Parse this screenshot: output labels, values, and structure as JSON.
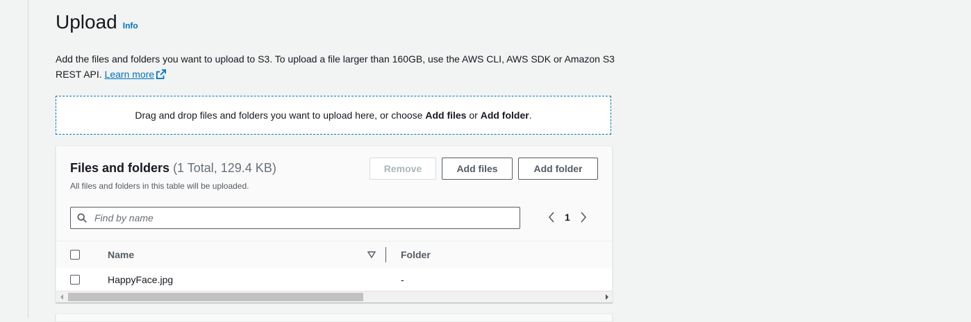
{
  "header": {
    "title": "Upload",
    "info_link": "Info"
  },
  "description": {
    "text": "Add the files and folders you want to upload to S3. To upload a file larger than 160GB, use the AWS CLI, AWS SDK or Amazon S3 REST API.",
    "learn_more": "Learn more"
  },
  "dropzone": {
    "prefix": "Drag and drop files and folders you want to upload here, or choose ",
    "add_files": "Add files",
    "middle": " or ",
    "add_folder": "Add folder",
    "suffix": "."
  },
  "files_panel": {
    "title": "Files and folders",
    "count": "(1 Total, 129.4 KB)",
    "subtitle": "All files and folders in this table will be uploaded.",
    "buttons": {
      "remove": "Remove",
      "add_files": "Add files",
      "add_folder": "Add folder"
    },
    "search": {
      "placeholder": "Find by name",
      "value": ""
    },
    "pagination": {
      "current_page": "1"
    },
    "table": {
      "columns": [
        "Name",
        "Folder"
      ],
      "rows": [
        {
          "name": "HappyFace.jpg",
          "folder": "-"
        }
      ]
    }
  },
  "colors": {
    "accent_link": "#0073bb",
    "text_primary": "#16191f",
    "text_secondary": "#545b64",
    "page_bg": "#f2f3f3"
  },
  "icons": {
    "external": "external-link-icon",
    "search": "search-icon",
    "sort": "sort-desc-icon",
    "prev": "chevron-left-icon",
    "next": "chevron-right-icon"
  }
}
